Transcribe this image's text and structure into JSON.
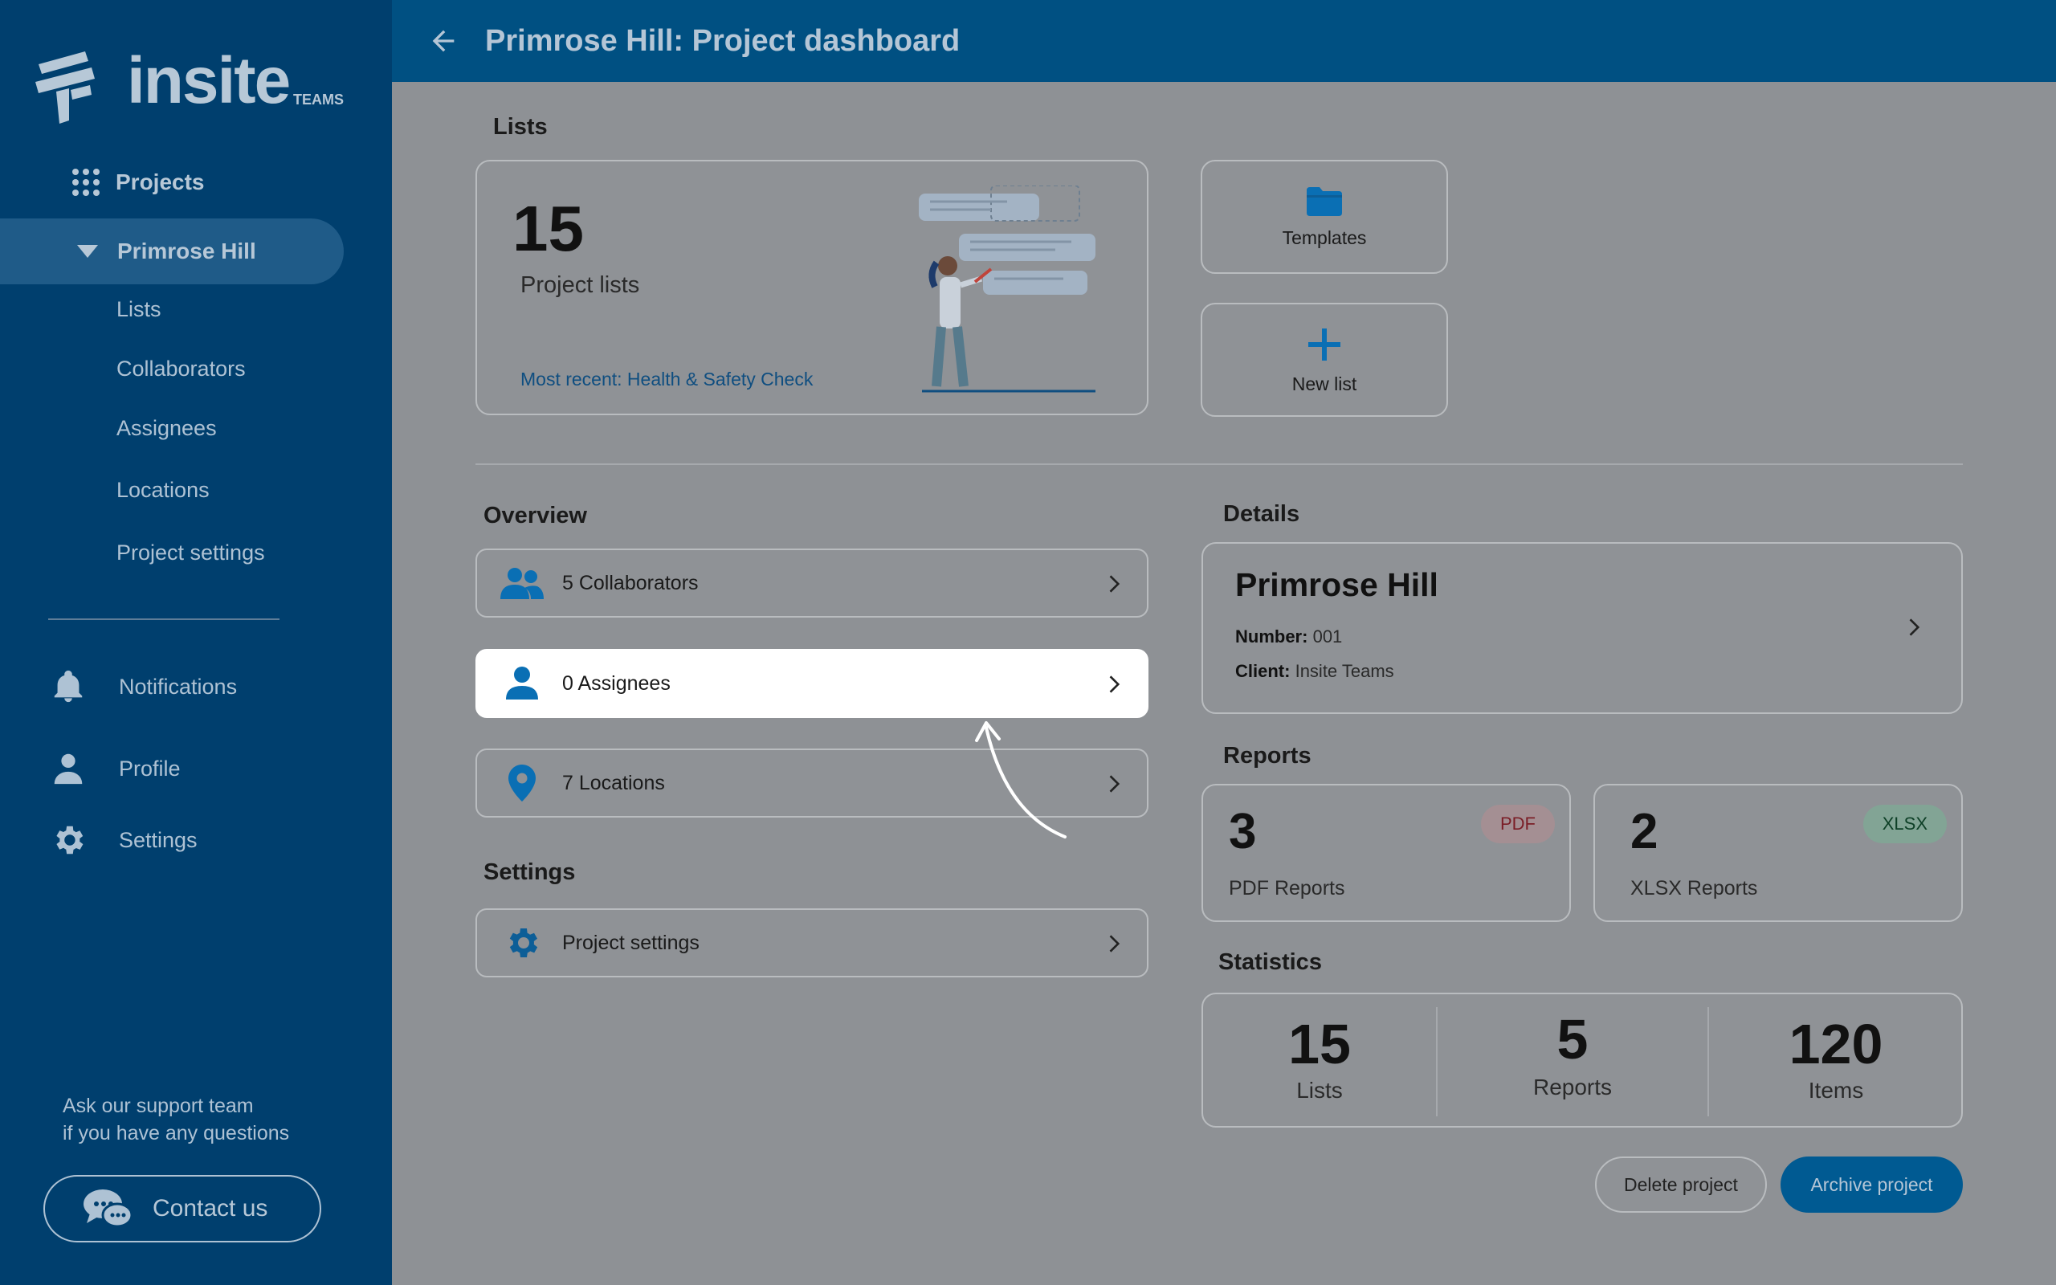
{
  "brand": {
    "name": "insite",
    "suffix": "TEAMS"
  },
  "sidebar": {
    "projects_label": "Projects",
    "active_project": "Primrose Hill",
    "sub_items": [
      "Lists",
      "Collaborators",
      "Assignees",
      "Locations",
      "Project settings"
    ],
    "links": [
      {
        "label": "Notifications",
        "icon": "bell-icon"
      },
      {
        "label": "Profile",
        "icon": "person-icon"
      },
      {
        "label": "Settings",
        "icon": "gear-icon"
      }
    ],
    "support_line1": "Ask our support team",
    "support_line2": "if you have any questions",
    "contact_label": "Contact us"
  },
  "header": {
    "title": "Primrose Hill: Project dashboard"
  },
  "lists": {
    "heading": "Lists",
    "count": "15",
    "subtitle": "Project lists",
    "recent": "Most recent: Health & Safety Check",
    "templates_label": "Templates",
    "new_list_label": "New list"
  },
  "overview": {
    "heading": "Overview",
    "collaborators": "5 Collaborators",
    "assignees": "0 Assignees",
    "locations": "7 Locations"
  },
  "settings": {
    "heading": "Settings",
    "project_settings": "Project settings"
  },
  "details": {
    "heading": "Details",
    "name": "Primrose Hill",
    "number_label": "Number:",
    "number": "001",
    "client_label": "Client:",
    "client": "Insite Teams"
  },
  "reports": {
    "heading": "Reports",
    "pdf_count": "3",
    "pdf_badge": "PDF",
    "pdf_label": "PDF Reports",
    "xlsx_count": "2",
    "xlsx_badge": "XLSX",
    "xlsx_label": "XLSX Reports"
  },
  "statistics": {
    "heading": "Statistics",
    "items": [
      {
        "value": "15",
        "label": "Lists"
      },
      {
        "value": "5",
        "label": "Reports"
      },
      {
        "value": "120",
        "label": "Items"
      }
    ]
  },
  "actions": {
    "delete": "Delete project",
    "archive": "Archive project"
  },
  "colors": {
    "sidebar": "#003f6e",
    "header": "#005082",
    "accent": "#005a92",
    "icon_blue": "#0a6fb4"
  }
}
